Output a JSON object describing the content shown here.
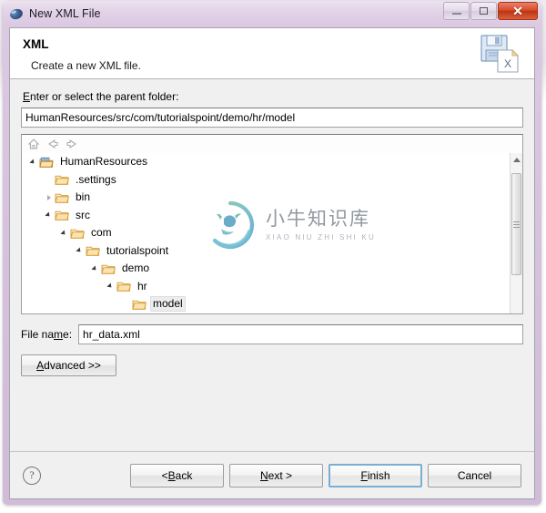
{
  "window": {
    "title": "New XML File",
    "app_icon": "eclipse-sphere-icon",
    "controls": {
      "minimize_label": "–",
      "maximize_label": "□",
      "close_label": "✕"
    }
  },
  "header": {
    "title": "XML",
    "description": "Create a new XML file.",
    "icon": "xml-save-file-icon"
  },
  "form": {
    "parent_folder_label_pre": "E",
    "parent_folder_label_post": "nter or select the parent folder:",
    "parent_folder_value": "HumanResources/src/com/tutorialspoint/demo/hr/model",
    "file_name_label_pre": "File na",
    "file_name_label_mid": "m",
    "file_name_label_post": "e:",
    "file_name_value": "hr_data.xml",
    "advanced_label_pre": "A",
    "advanced_label_post": "dvanced >>"
  },
  "tree_toolbar": {
    "home_icon": "home-icon",
    "back_icon": "back-arrow-icon",
    "forward_icon": "forward-arrow-icon"
  },
  "tree": {
    "nodes": [
      {
        "label": "HumanResources",
        "indent": 0,
        "twisty": "expanded",
        "icon": "project-folder-icon",
        "selected": false
      },
      {
        "label": ".settings",
        "indent": 1,
        "twisty": "none",
        "icon": "folder-icon",
        "selected": false
      },
      {
        "label": "bin",
        "indent": 1,
        "twisty": "collapsed",
        "icon": "folder-icon",
        "selected": false
      },
      {
        "label": "src",
        "indent": 1,
        "twisty": "expanded",
        "icon": "folder-icon",
        "selected": false
      },
      {
        "label": "com",
        "indent": 2,
        "twisty": "expanded",
        "icon": "folder-icon",
        "selected": false
      },
      {
        "label": "tutorialspoint",
        "indent": 3,
        "twisty": "expanded",
        "icon": "folder-icon",
        "selected": false
      },
      {
        "label": "demo",
        "indent": 4,
        "twisty": "expanded",
        "icon": "folder-icon",
        "selected": false
      },
      {
        "label": "hr",
        "indent": 5,
        "twisty": "expanded",
        "icon": "folder-icon",
        "selected": false
      },
      {
        "label": "model",
        "indent": 6,
        "twisty": "none",
        "icon": "folder-icon",
        "selected": true
      }
    ]
  },
  "watermark": {
    "chinese": "小牛知识库",
    "pinyin": "XIAO NIU ZHI SHI KU",
    "logo": "bull-circle-logo"
  },
  "footer": {
    "help_label": "?",
    "buttons": [
      {
        "name": "back-button",
        "pre": "< ",
        "accel": "B",
        "post": "ack",
        "default": false
      },
      {
        "name": "next-button",
        "pre": "",
        "accel": "N",
        "post": "ext >",
        "default": false
      },
      {
        "name": "finish-button",
        "pre": "",
        "accel": "F",
        "post": "inish",
        "default": true
      },
      {
        "name": "cancel-button",
        "pre": "",
        "accel": "",
        "post": "Cancel",
        "default": false
      }
    ]
  },
  "colors": {
    "titlebar": "#d5c2dc",
    "close_button": "#c93e1c",
    "dialog_bg": "#f0f0f0",
    "default_button_focus": "#7aafd4",
    "folder_icon": "#e8a33d",
    "watermark_text": "#8a9098"
  }
}
